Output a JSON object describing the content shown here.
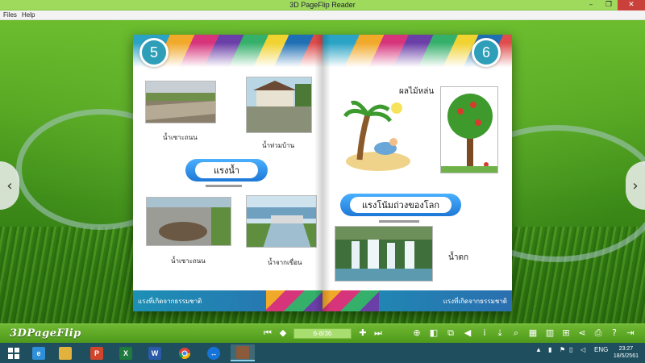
{
  "window": {
    "title": "3D PageFlip Reader",
    "minimize_glyph": "–",
    "maximize_glyph": "❐",
    "close_glyph": "✕"
  },
  "menu": {
    "items": [
      "Files",
      "Help"
    ]
  },
  "book": {
    "left_page": {
      "number": "5",
      "captions": [
        "น้ำเซาะถนน",
        "น้ำท่วมบ้าน",
        "น้ำเซาะถนน",
        "น้ำจากเขื่อน"
      ],
      "banner": "แรงน้ำ",
      "footer": "แรงที่เกิดจากธรรมชาติ"
    },
    "right_page": {
      "number": "6",
      "captions": [
        "ผลไม้หล่น",
        "น้ำตก"
      ],
      "banner": "แรงโน้มถ่วงของโลก",
      "footer": "แรงที่เกิดจากธรรมชาติ"
    }
  },
  "toolbar": {
    "brand": "3DPageFlip",
    "page_indicator": "6-8/36",
    "first_glyph": "⏮",
    "prev_glyph": "◆",
    "next_glyph": "✚",
    "last_glyph": "⏭",
    "tools": [
      "zoom-in",
      "single-page",
      "fullscreen",
      "sound",
      "info",
      "download",
      "search",
      "thumbnails",
      "bookmark",
      "share",
      "print",
      "help",
      "exit"
    ]
  },
  "taskbar": {
    "apps": [
      "start",
      "internet-explorer",
      "file-explorer",
      "powerpoint",
      "excel",
      "word",
      "chrome",
      "teamviewer",
      "pageflip-reader"
    ],
    "language": "ENG",
    "time": "23:27",
    "date": "18/5/2561"
  },
  "colors": {
    "toolbar": "#5aa624",
    "title_bar": "#9fda5d",
    "page_number": "#2f9fb9",
    "banner": "#1e78d6"
  }
}
